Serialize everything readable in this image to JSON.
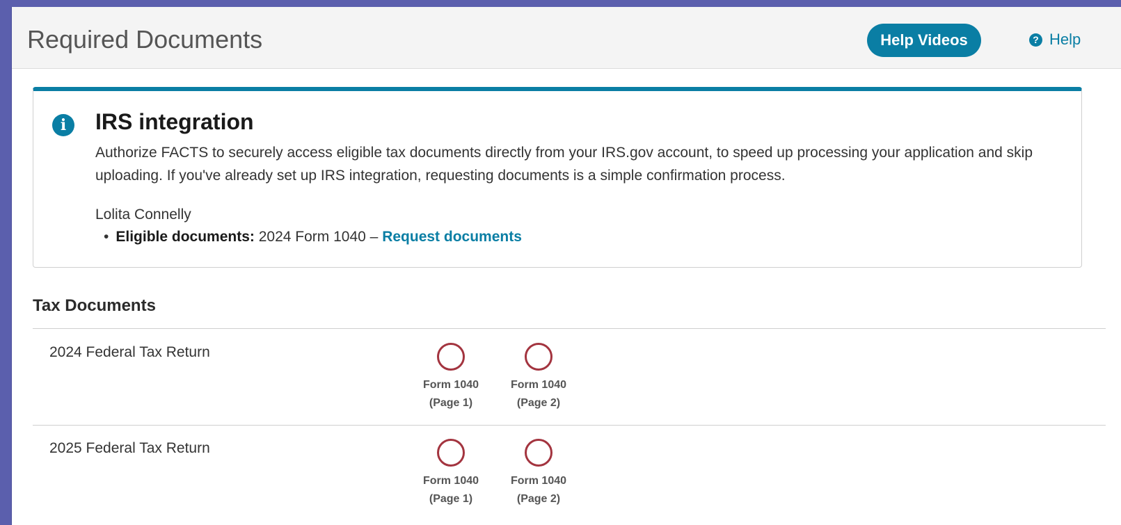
{
  "header": {
    "title": "Required Documents",
    "help_videos_label": "Help Videos",
    "help_label": "Help",
    "help_icon": "question-circle-icon"
  },
  "irs_card": {
    "icon": "info-icon",
    "title": "IRS integration",
    "description": "Authorize FACTS to securely access eligible tax documents directly from your IRS.gov account, to speed up processing your application and skip uploading. If you've already set up IRS integration, requesting documents is a simple confirmation process.",
    "person": "Lolita Connelly",
    "eligible_label": "Eligible documents:",
    "eligible_value": "2024 Form 1040 –",
    "request_link": "Request documents"
  },
  "tax_documents": {
    "section_title": "Tax Documents",
    "rows": [
      {
        "label": "2024 Federal Tax Return",
        "documents": [
          {
            "line1": "Form 1040",
            "line2": "(Page 1)"
          },
          {
            "line1": "Form 1040",
            "line2": "(Page 2)"
          }
        ]
      },
      {
        "label": "2025 Federal Tax Return",
        "documents": [
          {
            "line1": "Form 1040",
            "line2": "(Page 1)"
          },
          {
            "line1": "Form 1040",
            "line2": "(Page 2)"
          }
        ]
      }
    ]
  },
  "colors": {
    "accent": "#0a7ea4",
    "missing_status": "#a3343f",
    "outer_background": "#5b5fad"
  }
}
